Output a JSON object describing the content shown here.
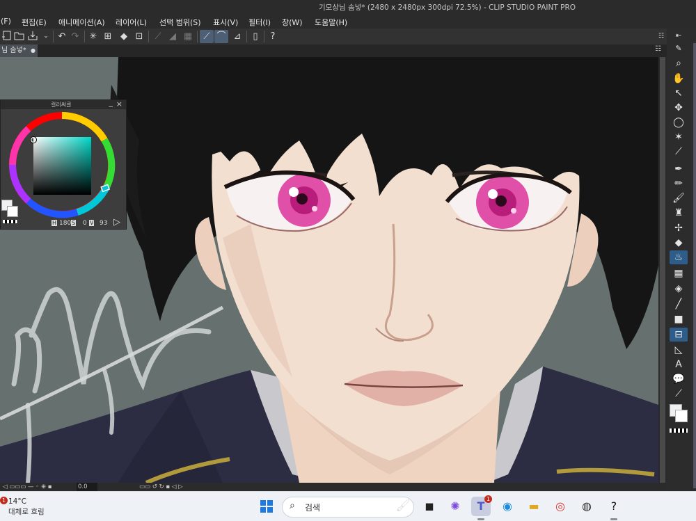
{
  "window": {
    "title": "기모상님 솜넣* (2480 x 2480px 300dpi 72.5%)  - CLIP STUDIO PAINT PRO"
  },
  "menu": [
    "(F)",
    "편집(E)",
    "애니메이션(A)",
    "레이어(L)",
    "선택 범위(S)",
    "표시(V)",
    "필터(I)",
    "창(W)",
    "도움말(H)"
  ],
  "toolbar_icons": [
    "new-icon",
    "open-icon",
    "save-icon",
    "export-icon",
    "undo-icon",
    "redo-icon",
    "busy-icon",
    "clear-icon",
    "fill-icon",
    "transform-icon",
    "snap-ruler-icon",
    "snap-special-icon",
    "snap-grid-icon",
    "ruler-icon",
    "ruler-curve-icon",
    "perspective-icon",
    "phone-icon",
    "help-icon"
  ],
  "document_tab": {
    "label": "님 솜넣*"
  },
  "color_panel": {
    "title": "컬러써클",
    "h_label": "H",
    "h_value": "180",
    "s_label": "S",
    "s_value": "0",
    "v_label": "V",
    "v_value": "93",
    "main_color": "#eef0f2",
    "selected_hue": "#00e0d0"
  },
  "status": {
    "value": "0.0"
  },
  "tool_rail": [
    "zoom-icon",
    "hand-icon",
    "object-icon",
    "move-icon",
    "lasso-icon",
    "magic-wand-icon",
    "eyedropper-icon",
    "pen-icon",
    "pencil-icon",
    "brush-icon",
    "airbrush-icon",
    "decoration-icon",
    "eraser-icon",
    "blend-icon",
    "fill-icon",
    "gradient-icon",
    "figure-icon",
    "frame-icon",
    "ruler-icon",
    "text-icon",
    "balloon-icon",
    "correction-icon"
  ],
  "taskbar": {
    "weather_badge": "1",
    "weather_temp": "14°C",
    "weather_desc": "대체로 흐림",
    "search_placeholder": "검색",
    "teams_badge": "1",
    "apps": [
      "start-icon",
      "widget-icon",
      "terminal-icon",
      "copilot-icon",
      "teams-icon",
      "edge-icon",
      "file-explorer-icon",
      "chrome-icon",
      "app-icon",
      "clip-studio-icon"
    ]
  }
}
